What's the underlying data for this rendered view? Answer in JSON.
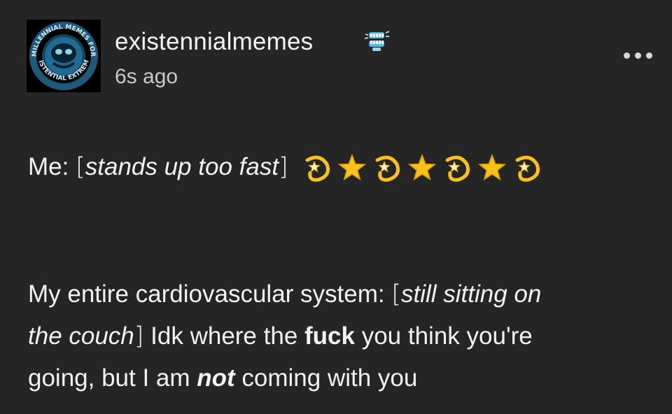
{
  "post": {
    "username": "existennialmemes",
    "timestamp": "6s ago",
    "avatar_alt_text_lines": [
      "MILLENNIAL MEMES FOR",
      "EXISTENTIAL EXTREMES"
    ],
    "badge_icon": "chattering-teeth-icon",
    "more_menu_icon": "more-dots-icon",
    "body": {
      "line1": {
        "speaker": "Me:",
        "action_open": "[",
        "action": "stands up too fast",
        "action_close": "]",
        "emoji_sequence": [
          "dizzy-icon",
          "star-icon",
          "dizzy-icon",
          "star-icon",
          "dizzy-icon",
          "star-icon",
          "dizzy-icon"
        ]
      },
      "line2": {
        "speaker": "My entire cardiovascular system:",
        "action_open": "[",
        "action_part1": "still sitting on"
      },
      "line3": {
        "action_part2": "the couch",
        "action_close": "]",
        "text_before": " Idk where the ",
        "emphasis_bold": "fuck",
        "text_after": " you think you're"
      },
      "line4": {
        "text_before": "going, but I am ",
        "emphasis_bold_italic": "not",
        "text_after": " coming with you"
      }
    }
  },
  "colors": {
    "background": "#252525",
    "text": "#f2f2f2",
    "muted": "#c9c9c9",
    "star": "#f7c21c",
    "badge": "#4fb7e6"
  }
}
